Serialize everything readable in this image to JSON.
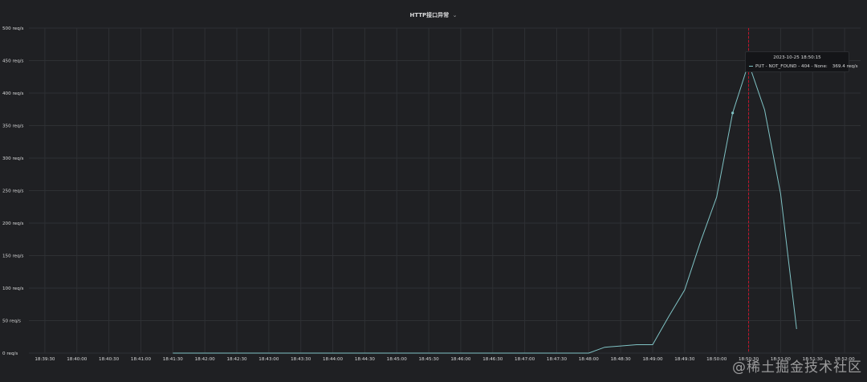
{
  "panel": {
    "title": "HTTP接口异常",
    "title_chevron": "⌄"
  },
  "tooltip": {
    "time": "2023-10-25 18:50:15",
    "series": "PUT - NOT_FOUND - 404 - None:",
    "value": "369.4 req/s"
  },
  "watermark": "@稀土掘金技术社区",
  "colors": {
    "background": "#1f2023",
    "grid": "#2e3034",
    "series": "#7fc2c4",
    "cursor": "#c4162a",
    "text": "#d8d9da"
  },
  "chart_data": {
    "type": "line",
    "title": "HTTP接口异常",
    "y_unit_suffix": " req/s",
    "ylim": [
      0,
      500
    ],
    "y_ticks": [
      0,
      50,
      100,
      150,
      200,
      250,
      300,
      350,
      400,
      450,
      500
    ],
    "y_tick_labels": [
      "0 req/s",
      "50 req/s",
      "100 req/s",
      "150 req/s",
      "200 req/s",
      "250 req/s",
      "300 req/s",
      "350 req/s",
      "400 req/s",
      "450 req/s",
      "500 req/s"
    ],
    "xlim": [
      "18:39:15",
      "18:52:15"
    ],
    "x_ticks": [
      "18:39:30",
      "18:40:00",
      "18:40:30",
      "18:41:00",
      "18:41:30",
      "18:42:00",
      "18:42:30",
      "18:43:00",
      "18:43:30",
      "18:44:00",
      "18:44:30",
      "18:45:00",
      "18:45:30",
      "18:46:00",
      "18:46:30",
      "18:47:00",
      "18:47:30",
      "18:48:00",
      "18:48:30",
      "18:49:00",
      "18:49:30",
      "18:50:00",
      "18:50:30",
      "18:51:00",
      "18:51:30",
      "18:52:00"
    ],
    "grid": true,
    "cursor_time": "18:50:30",
    "highlight_point": {
      "x": "18:50:15",
      "y": 369.4
    },
    "series": [
      {
        "name": "PUT - NOT_FOUND - 404 - None",
        "x": [
          "18:41:30",
          "18:42:00",
          "18:43:00",
          "18:44:00",
          "18:45:00",
          "18:46:00",
          "18:47:00",
          "18:48:00",
          "18:48:15",
          "18:48:30",
          "18:48:45",
          "18:49:00",
          "18:49:15",
          "18:49:30",
          "18:49:45",
          "18:50:00",
          "18:50:15",
          "18:50:30",
          "18:50:45",
          "18:51:00",
          "18:51:15"
        ],
        "values": [
          0,
          0,
          0,
          0,
          0,
          0,
          0,
          0,
          9,
          11,
          13,
          13,
          56,
          97,
          172,
          240,
          369.4,
          446,
          374,
          245,
          37
        ]
      }
    ]
  }
}
